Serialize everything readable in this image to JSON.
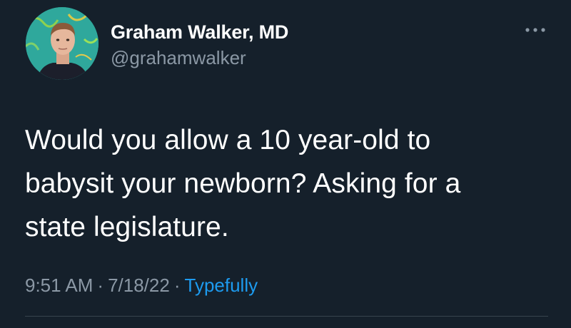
{
  "tweet": {
    "author": {
      "name": "Graham Walker, MD",
      "handle": "@grahamwalker"
    },
    "text_lines": [
      "Would you allow a 10 year-old to",
      "babysit your newborn? Asking for a",
      "state legislature."
    ],
    "time": "9:51 AM",
    "separator": "·",
    "date": "7/18/22",
    "source": "Typefully",
    "more_icon": "more-horizontal-icon"
  },
  "colors": {
    "background": "#15202b",
    "text_primary": "#ffffff",
    "text_secondary": "#8b98a5",
    "link": "#1d9bf0",
    "divider": "#38444d"
  }
}
